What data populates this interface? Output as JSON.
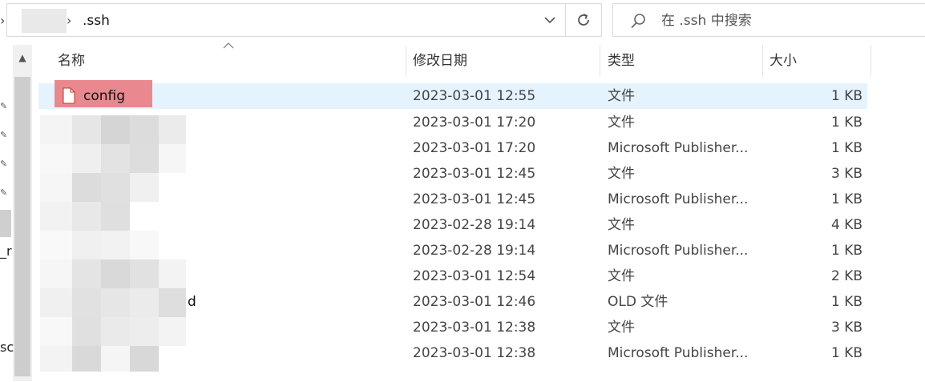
{
  "address_bar": {
    "current_folder": ".ssh"
  },
  "search": {
    "placeholder": "在 .ssh 中搜索"
  },
  "columns": {
    "name": "名称",
    "modified": "修改日期",
    "type": "类型",
    "size": "大小"
  },
  "sidebar": {
    "partial_text_1": "_r",
    "partial_text_2": "sc"
  },
  "files": [
    {
      "name": "config",
      "modified": "2023-03-01 12:55",
      "type": "文件",
      "size": "1 KB"
    },
    {
      "name": "",
      "modified": "2023-03-01 17:20",
      "type": "文件",
      "size": "1 KB"
    },
    {
      "name": "",
      "modified": "2023-03-01 17:20",
      "type": "Microsoft Publisher...",
      "size": "1 KB"
    },
    {
      "name": "",
      "modified": "2023-03-01 12:45",
      "type": "文件",
      "size": "3 KB"
    },
    {
      "name": "",
      "modified": "2023-03-01 12:45",
      "type": "Microsoft Publisher...",
      "size": "1 KB"
    },
    {
      "name": "",
      "modified": "2023-02-28 19:14",
      "type": "文件",
      "size": "4 KB"
    },
    {
      "name": "",
      "modified": "2023-02-28 19:14",
      "type": "Microsoft Publisher...",
      "size": "1 KB"
    },
    {
      "name": "",
      "modified": "2023-03-01 12:54",
      "type": "文件",
      "size": "2 KB"
    },
    {
      "name": "d",
      "modified": "2023-03-01 12:46",
      "type": "OLD 文件",
      "size": "1 KB"
    },
    {
      "name": "",
      "modified": "2023-03-01 12:38",
      "type": "文件",
      "size": "3 KB"
    },
    {
      "name": "",
      "modified": "2023-03-01 12:38",
      "type": "Microsoft Publisher...",
      "size": "1 KB"
    }
  ],
  "colors": {
    "selected_row": "#e5f3ff",
    "name_highlight": "#e9888f"
  }
}
